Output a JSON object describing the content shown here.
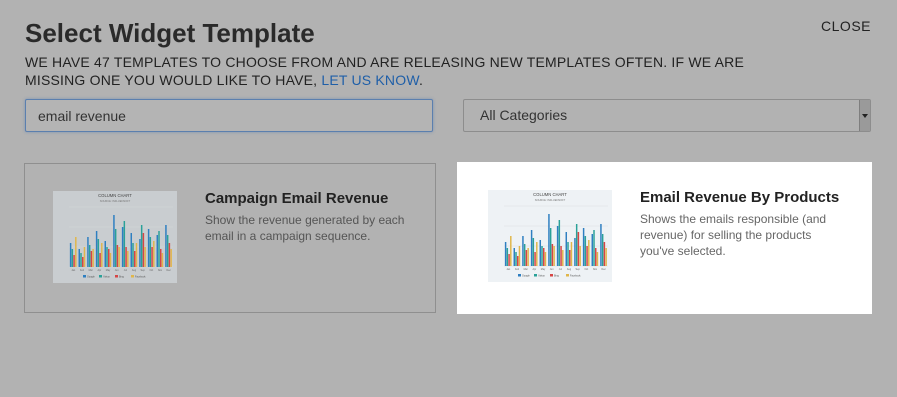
{
  "header": {
    "title": "Select Widget Template",
    "close_label": "CLOSE",
    "subtitle_text": "WE HAVE 47 TEMPLATES TO CHOOSE FROM AND ARE RELEASING NEW TEMPLATES OFTEN. IF WE ARE MISSING ONE YOU WOULD LIKE TO HAVE, ",
    "subtitle_link": "LET US KNOW",
    "subtitle_end": "."
  },
  "search": {
    "value": "email revenue"
  },
  "category": {
    "selected": "All Categories"
  },
  "templates": [
    {
      "title": "Campaign Email Revenue",
      "description": "Show the revenue generated by each email in a campaign sequence.",
      "thumbnail_title": "COLUMN CHART",
      "thumbnail_subtitle": "SOURCE: INFLUENSOFT",
      "selected": false
    },
    {
      "title": "Email Revenue By Products",
      "description": "Shows the emails responsible (and revenue) for selling the products you've selected.",
      "thumbnail_title": "COLUMN CHART",
      "thumbnail_subtitle": "SOURCE: INFLUENSOFT",
      "selected": true
    }
  ],
  "thumbnail_chart": {
    "categories": [
      "Jan",
      "Feb",
      "Mar",
      "Apr",
      "May",
      "Jun",
      "Jul",
      "Aug",
      "Sep",
      "Oct",
      "Nov",
      "Dec"
    ],
    "series": [
      {
        "name": "Google",
        "color": "#2e7fc1",
        "values": [
          120,
          90,
          150,
          180,
          130,
          260,
          200,
          170,
          140,
          190,
          160,
          210
        ]
      },
      {
        "name": "Yahoo",
        "color": "#2aa198",
        "values": [
          90,
          70,
          110,
          140,
          100,
          190,
          230,
          120,
          210,
          150,
          180,
          160
        ]
      },
      {
        "name": "Bing",
        "color": "#d64545",
        "values": [
          60,
          50,
          80,
          70,
          90,
          110,
          100,
          80,
          170,
          100,
          90,
          120
        ]
      },
      {
        "name": "Facebook",
        "color": "#e0b64a",
        "values": [
          150,
          100,
          90,
          120,
          70,
          100,
          80,
          120,
          100,
          130,
          70,
          90
        ]
      }
    ],
    "ylim": [
      0,
      300
    ]
  },
  "colors": {
    "link": "#1f5fa8",
    "overlay_bg": "#b2b2b2",
    "selected_card_bg": "#ffffff"
  }
}
